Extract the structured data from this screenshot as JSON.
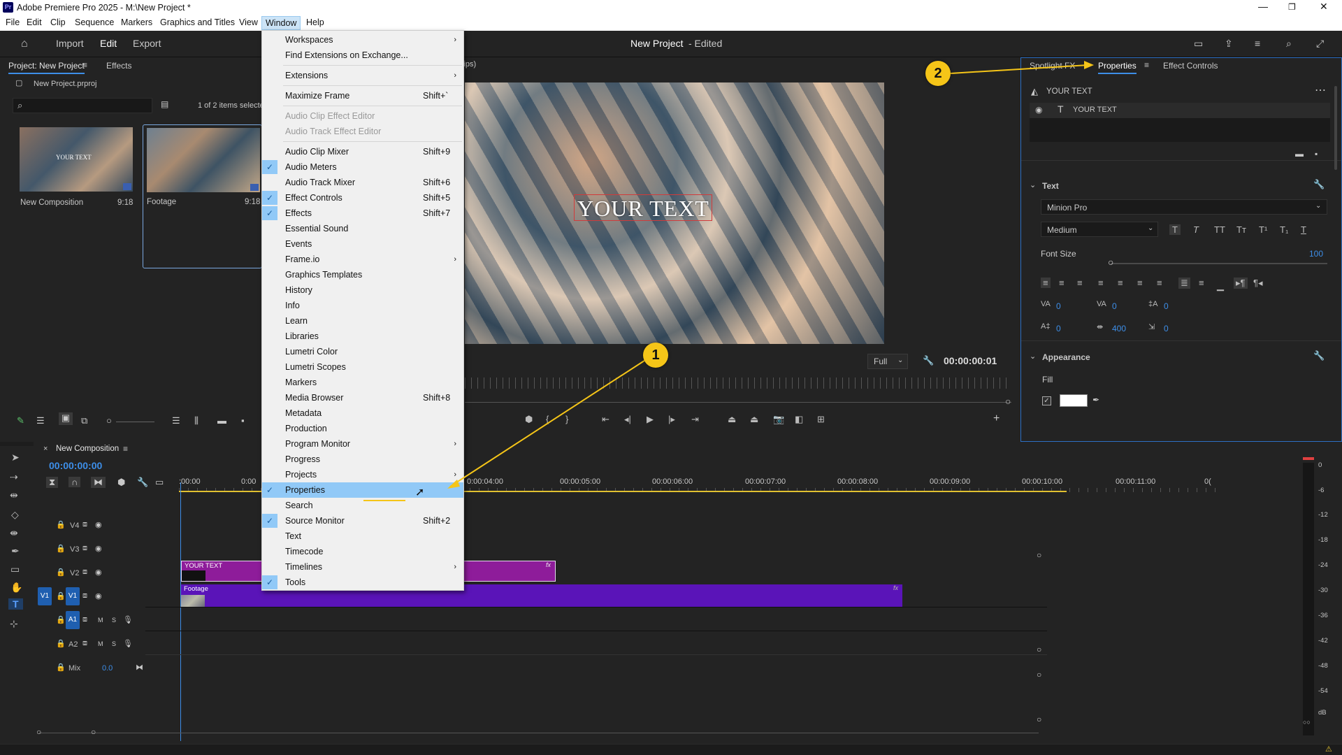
{
  "window": {
    "app_icon": "Pr",
    "title": "Adobe Premiere Pro 2025 - M:\\New Project *"
  },
  "menubar": [
    "File",
    "Edit",
    "Clip",
    "Sequence",
    "Markers",
    "Graphics and Titles",
    "View",
    "Window",
    "Help"
  ],
  "header": {
    "tabs": [
      "Import",
      "Edit",
      "Export"
    ],
    "project_title": "New Project",
    "project_status": "- Edited"
  },
  "project_panel": {
    "tab": "Project: New Project",
    "tab2": "Effects",
    "file": "New Project.prproj",
    "count": "1 of 2 items selecte",
    "items": [
      {
        "name": "New Composition",
        "duration": "9:18",
        "thumb_text": "YOUR TEXT"
      },
      {
        "name": "Footage",
        "duration": "9:18"
      }
    ]
  },
  "program_monitor": {
    "title_fragment": "lips)",
    "overlay_text": "YOUR TEXT",
    "quality": "Full",
    "timecode": "00:00:00:01"
  },
  "window_menu": [
    {
      "label": "Workspaces",
      "submenu": true
    },
    {
      "label": "Find Extensions on Exchange..."
    },
    {
      "label": "Extensions",
      "submenu": true
    },
    {
      "label": "Maximize Frame",
      "shortcut": "Shift+`"
    },
    {
      "label": "Audio Clip Effect Editor",
      "disabled": true
    },
    {
      "label": "Audio Track Effect Editor",
      "disabled": true
    },
    {
      "label": "Audio Clip Mixer",
      "shortcut": "Shift+9"
    },
    {
      "label": "Audio Meters",
      "checked": true
    },
    {
      "label": "Audio Track Mixer",
      "shortcut": "Shift+6"
    },
    {
      "label": "Effect Controls",
      "shortcut": "Shift+5",
      "checked": true
    },
    {
      "label": "Effects",
      "shortcut": "Shift+7",
      "checked": true
    },
    {
      "label": "Essential Sound"
    },
    {
      "label": "Events"
    },
    {
      "label": "Frame.io",
      "submenu": true
    },
    {
      "label": "Graphics Templates"
    },
    {
      "label": "History"
    },
    {
      "label": "Info"
    },
    {
      "label": "Learn"
    },
    {
      "label": "Libraries"
    },
    {
      "label": "Lumetri Color"
    },
    {
      "label": "Lumetri Scopes"
    },
    {
      "label": "Markers"
    },
    {
      "label": "Media Browser",
      "shortcut": "Shift+8"
    },
    {
      "label": "Metadata"
    },
    {
      "label": "Production"
    },
    {
      "label": "Program Monitor",
      "submenu": true
    },
    {
      "label": "Progress"
    },
    {
      "label": "Projects",
      "submenu": true
    },
    {
      "label": "Properties",
      "checked": true,
      "highlighted": true
    },
    {
      "label": "Search"
    },
    {
      "label": "Source Monitor",
      "shortcut": "Shift+2",
      "checked": true
    },
    {
      "label": "Text"
    },
    {
      "label": "Timecode"
    },
    {
      "label": "Timelines",
      "submenu": true
    },
    {
      "label": "Tools",
      "checked": true
    }
  ],
  "callouts": [
    "1",
    "2"
  ],
  "properties_panel": {
    "tabs": [
      "Spotlight FX",
      "Properties",
      "Effect Controls"
    ],
    "layer_name": "YOUR TEXT",
    "text_layer": "YOUR TEXT",
    "text_section": "Text",
    "font": "Minion Pro",
    "style": "Medium",
    "font_size_label": "Font Size",
    "font_size": "100",
    "tracking": "0",
    "kerning": "0",
    "leading": "0",
    "baseline": "0",
    "tsume": "400",
    "indent": "0",
    "appearance_section": "Appearance",
    "fill_label": "Fill",
    "fill_color": "#ffffff"
  },
  "timeline": {
    "sequence": "New Composition",
    "timecode": "00:00:00:00",
    "ruler": [
      "00:00",
      "00:00:05:00",
      "00:00:04:00",
      "00:00:05:00",
      "00:00:06:00",
      "00:00:07:00",
      "00:00:08:00",
      "00:00:09:00",
      "00:00:10:00",
      "00:00:11:00"
    ],
    "ruler_display": [
      ":00:00",
      "0:00",
      "0:00:04:00",
      "00:00:05:00",
      "00:00:06:00",
      "00:00:07:00",
      "00:00:08:00",
      "00:00:09:00",
      "00:00:10:00",
      "00:00:11:00",
      "0("
    ],
    "tracks": [
      "V4",
      "V3",
      "V2",
      "V1",
      "A1",
      "A2"
    ],
    "mix_label": "Mix",
    "mix_value": "0.0",
    "clips": [
      {
        "name": "YOUR TEXT",
        "track": "V2",
        "color": "#8e1c9a"
      },
      {
        "name": "Footage",
        "track": "V1",
        "color": "#5a14b8"
      }
    ]
  },
  "audio_meter": {
    "scale": [
      "0",
      "-6",
      "-12",
      "-18",
      "-24",
      "-30",
      "-36",
      "-42",
      "-48",
      "-54"
    ],
    "unit": "dB"
  }
}
